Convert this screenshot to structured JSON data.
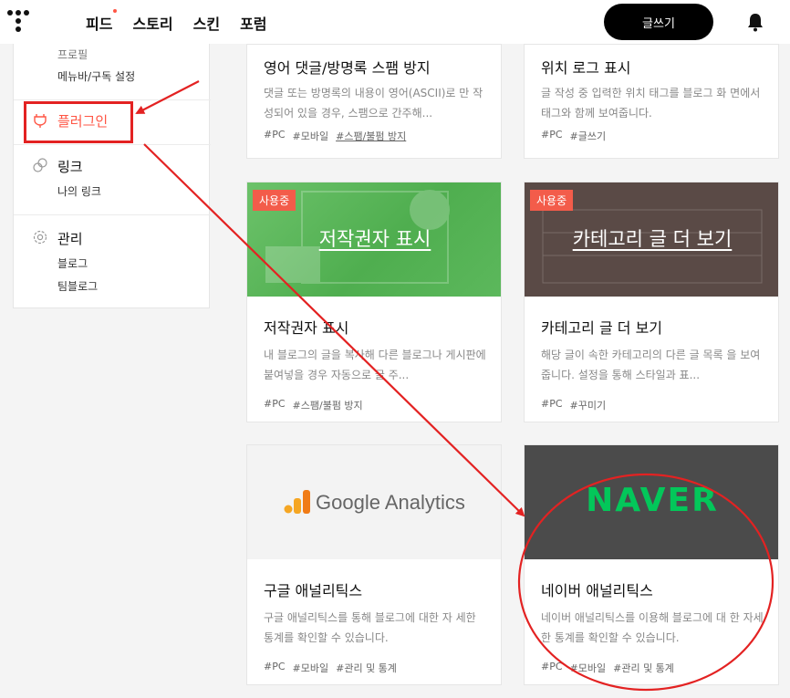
{
  "nav": {
    "items": [
      "피드",
      "스토리",
      "스킨",
      "포럼"
    ],
    "write_label": "글쓰기"
  },
  "sidebar": {
    "partial_top": "프로필",
    "menu_settings": "메뉴바/구독 설정",
    "plugin": "플러그인",
    "link": "링크",
    "link_sub": "나의 링크",
    "manage": "관리",
    "manage_sub1": "블로그",
    "manage_sub2": "팀블로그"
  },
  "cards": {
    "spam": {
      "title": "영어 댓글/방명록 스팸 방지",
      "desc": "댓글 또는 방명록의 내용이 영어(ASCII)로 만 작성되어 있을 경우, 스팸으로 간주해...",
      "tags": [
        "#PC",
        "#모바일",
        "#스팸/불펌 방지"
      ]
    },
    "location": {
      "title": "위치 로그 표시",
      "desc": "글 작성 중 입력한 위치 태그를 블로그 화 면에서 태그와 함께 보여줍니다.",
      "tags": [
        "#PC",
        "#글쓰기"
      ]
    },
    "copyright": {
      "badge": "사용중",
      "thumb_title": "저작권자 표시",
      "title": "저작권자 표시",
      "desc": "내 블로그의 글을 복사해 다른 블로그나 게시판에 붙여넣을 경우 자동으로 글 주...",
      "tags": [
        "#PC",
        "#스팸/불펌 방지"
      ],
      "color": "#5cb85c"
    },
    "category": {
      "badge": "사용중",
      "thumb_title": "카테고리 글 더 보기",
      "title": "카테고리 글 더 보기",
      "desc": "해당 글이 속한 카테고리의 다른 글 목록 을 보여줍니다. 설정을 통해 스타일과 표...",
      "tags": [
        "#PC",
        "#꾸미기"
      ],
      "color": "#5a4a46"
    },
    "google": {
      "logo_text": "Google Analytics",
      "title": "구글 애널리틱스",
      "desc": "구글 애널리틱스를 통해 블로그에 대한 자 세한 통계를 확인할 수 있습니다.",
      "tags": [
        "#PC",
        "#모바일",
        "#관리 및 통계"
      ]
    },
    "naver": {
      "logo_text": "NAVER",
      "title": "네이버 애널리틱스",
      "desc": "네이버 애널리틱스를 이용해 블로그에 대 한 자세한 통계를 확인할 수 있습니다.",
      "tags": [
        "#PC",
        "#모바일",
        "#관리 및 통계"
      ],
      "color": "#03c75a"
    }
  },
  "colors": {
    "accent": "#ff5544",
    "annotation": "#e32222"
  }
}
